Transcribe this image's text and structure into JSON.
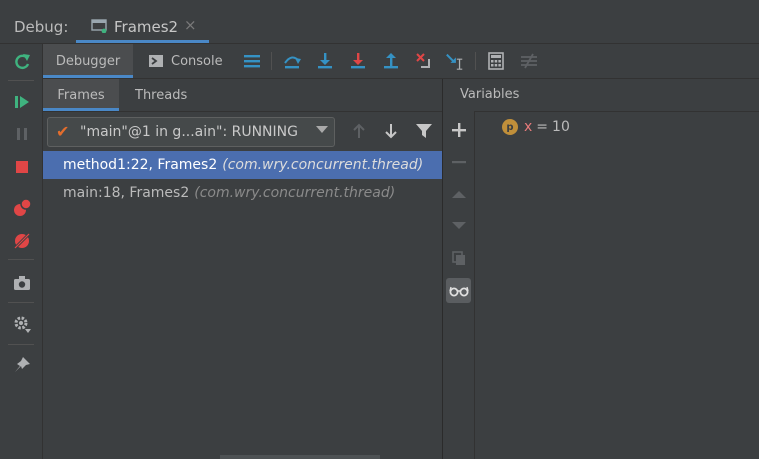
{
  "titlebar": {
    "label": "Debug:",
    "tab_title": "Frames2",
    "close_glyph": "×"
  },
  "toolbar": {
    "debugger_label": "Debugger",
    "console_label": "Console"
  },
  "frames_panel": {
    "tabs": [
      "Frames",
      "Threads"
    ],
    "thread_select": "\"main\"@1 in g...ain\": RUNNING",
    "frames": [
      {
        "method": "method1:22, Frames2",
        "pkg": "(com.wry.concurrent.thread)",
        "selected": true
      },
      {
        "method": "main:18, Frames2",
        "pkg": "(com.wry.concurrent.thread)",
        "selected": false
      }
    ]
  },
  "variables": {
    "title": "Variables",
    "items": [
      {
        "badge": "p",
        "name": "x",
        "eq": "=",
        "value": "10"
      }
    ]
  },
  "colors": {
    "accent": "#4a88c7",
    "selection": "#4b6eaf",
    "green": "#3fb37f",
    "red": "#e04646",
    "blue": "#3592c4"
  }
}
